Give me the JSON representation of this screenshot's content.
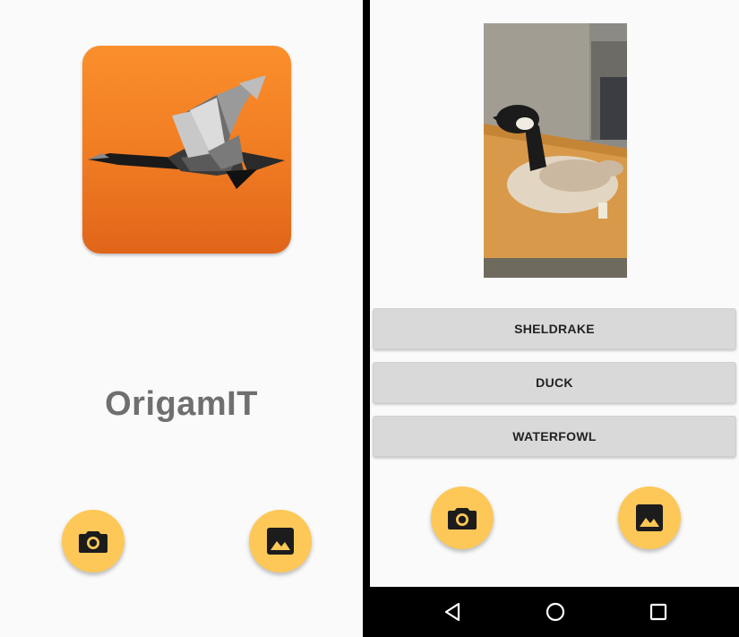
{
  "left_screen": {
    "logo": {
      "icon": "origami-goose-logo",
      "background_color": "#f58426"
    },
    "title": "OrigamIT",
    "camera_button": {
      "icon": "camera-icon"
    },
    "gallery_button": {
      "icon": "image-icon"
    }
  },
  "right_screen": {
    "photo": {
      "subject": "goose-plush-photo"
    },
    "results": [
      {
        "label": "SHELDRAKE"
      },
      {
        "label": "DUCK"
      },
      {
        "label": "WATERFOWL"
      }
    ],
    "camera_button": {
      "icon": "camera-icon"
    },
    "gallery_button": {
      "icon": "image-icon"
    },
    "nav_bar": {
      "back": {
        "icon": "back-triangle-icon"
      },
      "home": {
        "icon": "home-circle-icon"
      },
      "recents": {
        "icon": "recents-square-icon"
      }
    }
  },
  "colors": {
    "fab": "#fdc857",
    "screen_background": "#fafafa",
    "button_background": "#d9d9d9",
    "title_text": "#6f6f6f"
  }
}
